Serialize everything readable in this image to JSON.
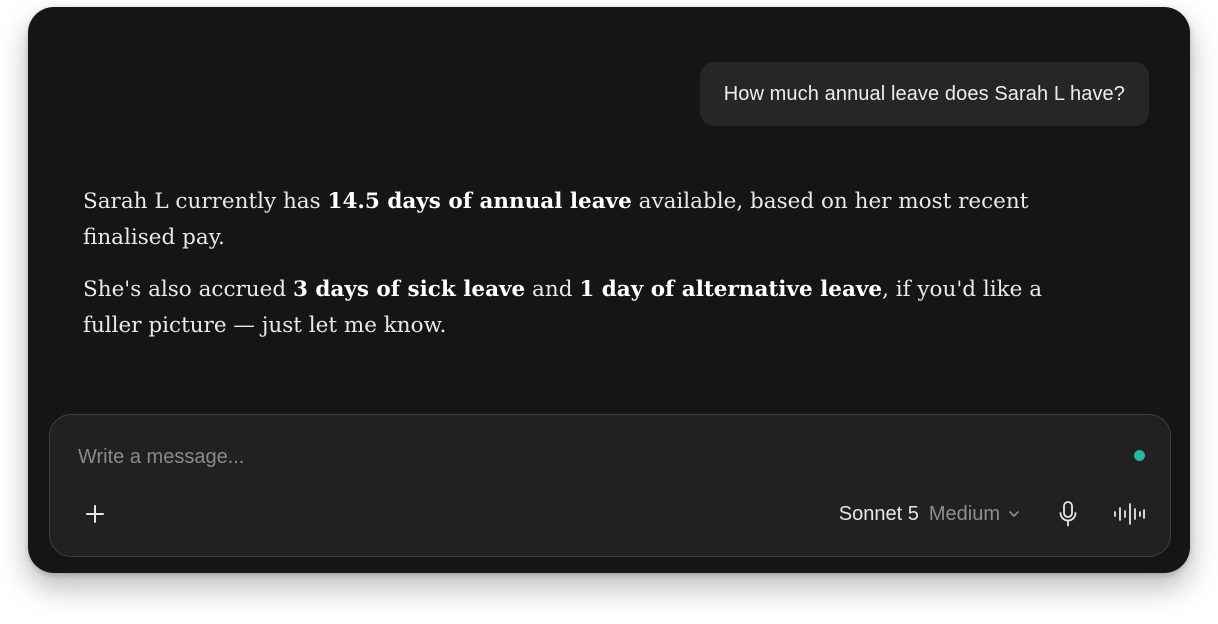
{
  "conversation": {
    "user_message": "How much annual leave does Sarah L have?",
    "assistant": {
      "p1": {
        "before": "Sarah L currently has ",
        "bold": "14.5 days of annual leave",
        "after": " available, based on her most recent finalised pay."
      },
      "p2": {
        "before": "She's also accrued ",
        "bold1": "3 days of sick leave",
        "middle": " and ",
        "bold2": "1 day of alternative leave",
        "after": ", if you'd like a fuller picture — just let me know."
      }
    }
  },
  "composer": {
    "placeholder": "Write a message...",
    "value": "",
    "model_name": "Sonnet 5",
    "model_effort": "Medium",
    "status_color": "#2bb5a0"
  },
  "icons": {
    "add": "plus-icon",
    "model_dropdown": "chevron-down-icon",
    "mic": "microphone-icon",
    "voice": "waveform-icon"
  }
}
